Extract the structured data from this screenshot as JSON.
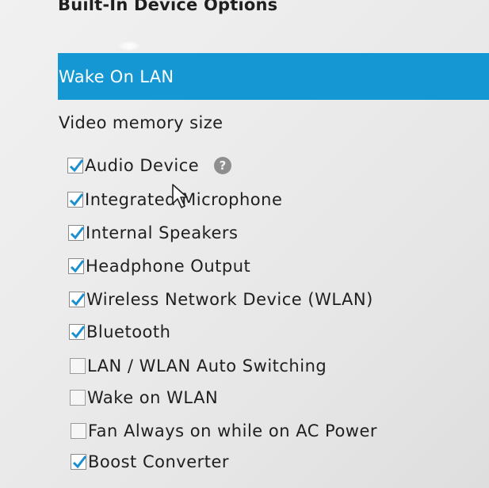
{
  "page": {
    "title": "Built-In Device Options"
  },
  "options": {
    "selected_label": "Wake On LAN",
    "video_memory_label": "Video memory size"
  },
  "checkboxes": [
    {
      "label": "Audio Device",
      "checked": true,
      "has_help_icon": true
    },
    {
      "label": "Integrated Microphone",
      "checked": true
    },
    {
      "label": "Internal Speakers",
      "checked": true
    },
    {
      "label": "Headphone Output",
      "checked": true
    },
    {
      "label": "Wireless Network Device (WLAN)",
      "checked": true
    },
    {
      "label": "Bluetooth",
      "checked": true
    },
    {
      "label": "LAN / WLAN Auto Switching",
      "checked": false
    },
    {
      "label": "Wake on WLAN",
      "checked": false
    },
    {
      "label": "Fan Always on while on AC Power",
      "checked": false
    },
    {
      "label": "Boost Converter",
      "checked": true
    }
  ],
  "icons": {
    "help": "question-mark-icon",
    "check": "checkmark-icon",
    "cursor": "mouse-pointer-icon"
  },
  "colors": {
    "selection": "#1597d3",
    "checkmark": "#1a8fd0"
  }
}
